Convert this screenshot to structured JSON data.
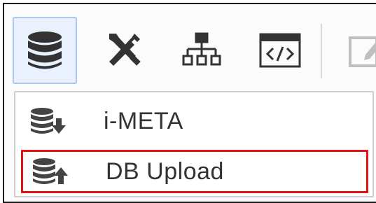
{
  "toolbar": {
    "buttons": [
      {
        "icon": "database-icon",
        "active": true
      },
      {
        "icon": "tools-icon",
        "active": false
      },
      {
        "icon": "hierarchy-icon",
        "active": false
      },
      {
        "icon": "code-window-icon",
        "active": false
      },
      {
        "icon": "edit-icon",
        "active": false
      }
    ],
    "colors": {
      "active_bg": "#e8f1fd",
      "active_border": "#a9c8ef",
      "icon": "#333333"
    }
  },
  "menu": {
    "items": [
      {
        "label": "i-META",
        "icon": "database-download-icon",
        "highlighted": false
      },
      {
        "label": "DB Upload",
        "icon": "database-upload-icon",
        "highlighted": true
      }
    ],
    "highlight_color": "#e01414"
  }
}
